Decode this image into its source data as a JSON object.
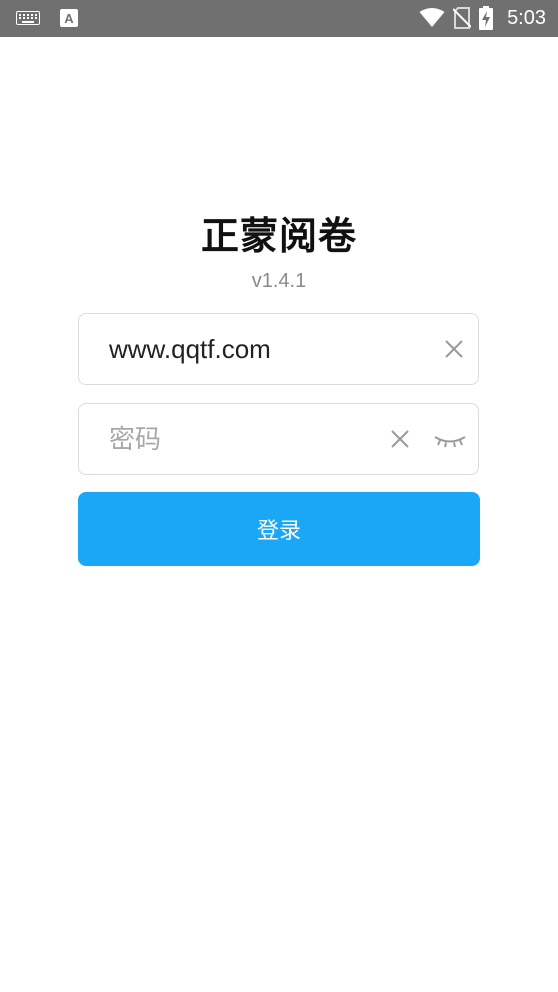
{
  "status_bar": {
    "time": "5:03",
    "icons": [
      "keyboard-icon",
      "text-input-icon",
      "wifi-icon",
      "no-sim-icon",
      "battery-charging-icon"
    ]
  },
  "app": {
    "title": "正蒙阅卷",
    "version": "v1.4.1"
  },
  "login_form": {
    "username_value": "www.qqtf.com",
    "password_placeholder": "密码",
    "login_label": "登录"
  },
  "colors": {
    "status_bar": "#707070",
    "primary": "#1aa7f5",
    "border": "#dcdcdc",
    "placeholder": "#a8a8a8"
  }
}
